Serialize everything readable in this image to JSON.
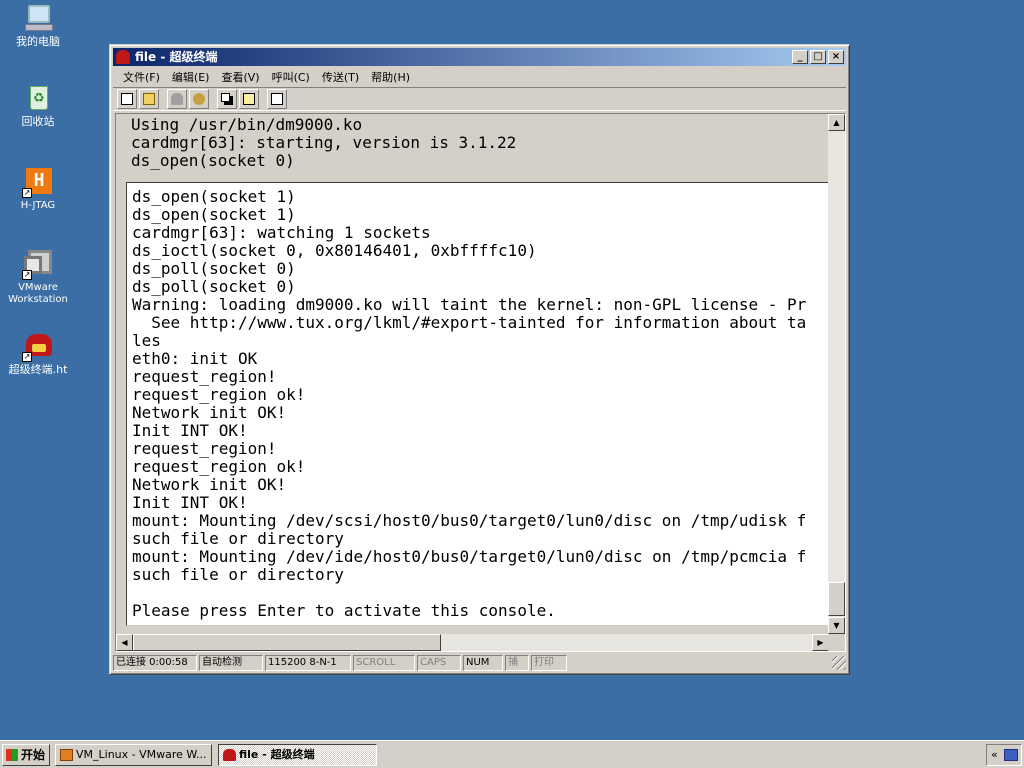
{
  "desktop": {
    "icons": [
      {
        "label": "我的电脑"
      },
      {
        "label": "回收站"
      },
      {
        "label": "H-JTAG"
      },
      {
        "label": "VMware Workstation"
      },
      {
        "label": "超级终端.ht"
      }
    ]
  },
  "window": {
    "title": "file - 超级终端",
    "controls": {
      "minimize": "_",
      "maximize": "□",
      "close": "×"
    },
    "menu": [
      "文件(F)",
      "编辑(E)",
      "查看(V)",
      "呼叫(C)",
      "传送(T)",
      "帮助(H)"
    ],
    "toolbar": [
      "new-icon",
      "open-icon",
      "call-icon",
      "hangup-icon",
      "send-icon",
      "receive-icon",
      "properties-icon"
    ]
  },
  "terminal": {
    "gray_lines": [
      "Using /usr/bin/dm9000.ko",
      "cardmgr[63]: starting, version is 3.1.22",
      "ds_open(socket 0)"
    ],
    "lines": [
      "ds_open(socket 1)",
      "ds_open(socket 1)",
      "cardmgr[63]: watching 1 sockets",
      "ds_ioctl(socket 0, 0x80146401, 0xbffffc10)",
      "ds_poll(socket 0)",
      "ds_poll(socket 0)",
      "Warning: loading dm9000.ko will taint the kernel: non-GPL license - Pr",
      "  See http://www.tux.org/lkml/#export-tainted for information about ta",
      "les",
      "eth0: init OK",
      "request_region!",
      "request_region ok!",
      "Network init OK!",
      "Init INT OK!",
      "request_region!",
      "request_region ok!",
      "Network init OK!",
      "Init INT OK!",
      "mount: Mounting /dev/scsi/host0/bus0/target0/lun0/disc on /tmp/udisk f",
      "such file or directory",
      "mount: Mounting /dev/ide/host0/bus0/target0/lun0/disc on /tmp/pcmcia f",
      "such file or directory",
      "",
      "Please press Enter to activate this console."
    ]
  },
  "statusbar": {
    "connected": "已连接 0:00:58",
    "detect": "自动检测",
    "params": "115200 8-N-1",
    "scroll": "SCROLL",
    "caps": "CAPS",
    "num": "NUM",
    "capture": "捕",
    "print": "打印"
  },
  "taskbar": {
    "start": "开始",
    "tasks": [
      {
        "label": "VM_Linux - VMware W..."
      },
      {
        "label": "file - 超级终端"
      }
    ],
    "tray": "«"
  }
}
